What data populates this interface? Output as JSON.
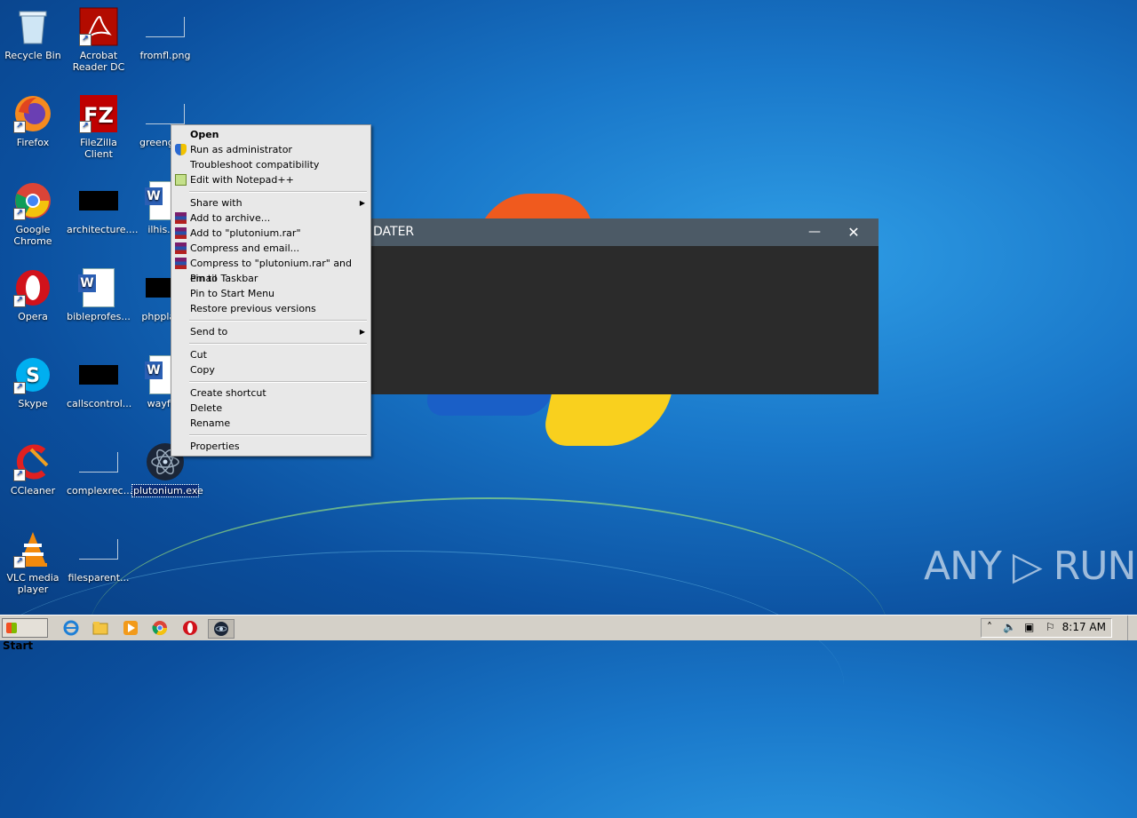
{
  "desktop_icons": [
    {
      "label": "Recycle Bin"
    },
    {
      "label": "Acrobat Reader DC"
    },
    {
      "label": "fromfl.png"
    },
    {
      "label": "Firefox"
    },
    {
      "label": "FileZilla Client"
    },
    {
      "label": "greengiv..."
    },
    {
      "label": "Google Chrome"
    },
    {
      "label": "architecture...."
    },
    {
      "label": "ilhis.r..."
    },
    {
      "label": "Opera"
    },
    {
      "label": "bibleprofes..."
    },
    {
      "label": "phpplay..."
    },
    {
      "label": "Skype"
    },
    {
      "label": "callscontrol..."
    },
    {
      "label": "wayft..."
    },
    {
      "label": "CCleaner"
    },
    {
      "label": "complexrec..."
    },
    {
      "label": "plutonium.exe"
    },
    {
      "label": "VLC media player"
    },
    {
      "label": "filesparent..."
    }
  ],
  "background_window": {
    "title": "DATER",
    "minimize": "—",
    "close": "✕"
  },
  "context_menu": {
    "items": [
      {
        "label": "Open"
      },
      {
        "label": "Run as administrator"
      },
      {
        "label": "Troubleshoot compatibility"
      },
      {
        "label": "Edit with Notepad++"
      },
      {
        "label": "Share with"
      },
      {
        "label": "Add to archive..."
      },
      {
        "label": "Add to \"plutonium.rar\""
      },
      {
        "label": "Compress and email..."
      },
      {
        "label": "Compress to \"plutonium.rar\" and email"
      },
      {
        "label": "Pin to Taskbar"
      },
      {
        "label": "Pin to Start Menu"
      },
      {
        "label": "Restore previous versions"
      },
      {
        "label": "Send to"
      },
      {
        "label": "Cut"
      },
      {
        "label": "Copy"
      },
      {
        "label": "Create shortcut"
      },
      {
        "label": "Delete"
      },
      {
        "label": "Rename"
      },
      {
        "label": "Properties"
      }
    ]
  },
  "taskbar": {
    "start_label": "Start",
    "pinned": [
      "internet-explorer",
      "file-explorer",
      "media-player",
      "chrome",
      "opera",
      "plutonium"
    ],
    "clock": "8:17 AM"
  },
  "watermark": "ANY ▷ RUN"
}
